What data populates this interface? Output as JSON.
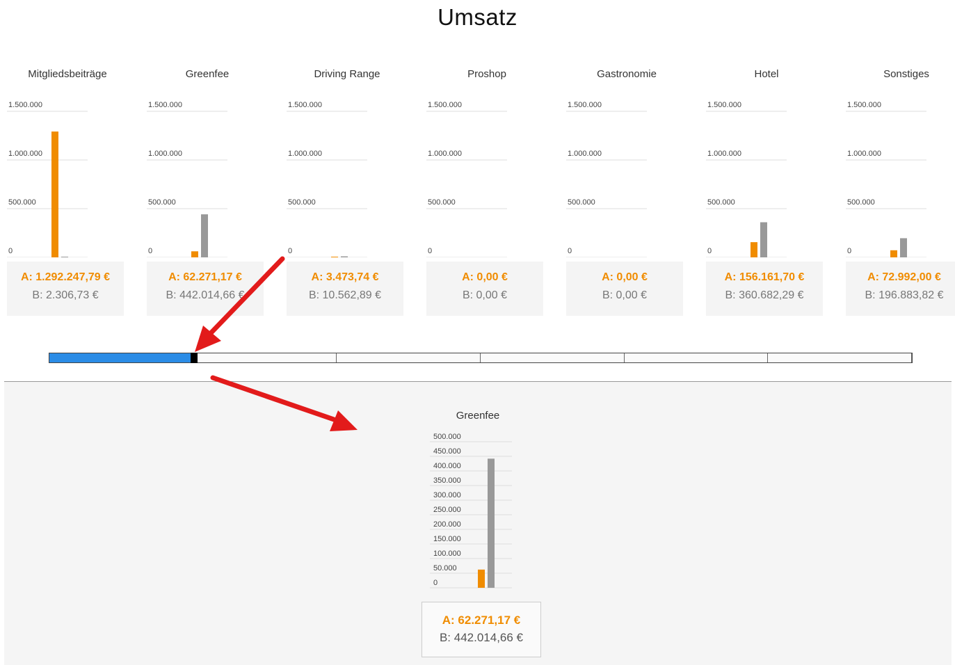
{
  "title": "Umsatz",
  "colors": {
    "a": "#f08c00",
    "b": "#999999",
    "slider_active": "#2b8ce6",
    "arrow": "#e21b1b"
  },
  "panels": [
    {
      "name": "Mitgliedsbeiträge",
      "a": 1292247.79,
      "b": 2306.73,
      "a_label": "A: 1.292.247,79 €",
      "b_label": "B: 2.306,73 €"
    },
    {
      "name": "Greenfee",
      "a": 62271.17,
      "b": 442014.66,
      "a_label": "A: 62.271,17 €",
      "b_label": "B: 442.014,66 €"
    },
    {
      "name": "Driving Range",
      "a": 3473.74,
      "b": 10562.89,
      "a_label": "A: 3.473,74 €",
      "b_label": "B: 10.562,89 €"
    },
    {
      "name": "Proshop",
      "a": 0,
      "b": 0,
      "a_label": "A: 0,00 €",
      "b_label": "B: 0,00 €"
    },
    {
      "name": "Gastronomie",
      "a": 0,
      "b": 0,
      "a_label": "A: 0,00 €",
      "b_label": "B: 0,00 €"
    },
    {
      "name": "Hotel",
      "a": 156161.7,
      "b": 360682.29,
      "a_label": "A: 156.161,70 €",
      "b_label": "B: 360.682,29 €"
    },
    {
      "name": "Sonstiges",
      "a": 72992.0,
      "b": 196883.82,
      "a_label": "A: 72.992,00 €",
      "b_label": "B: 196.883,82 €"
    }
  ],
  "panel_axis": {
    "ylim": [
      0,
      1500000
    ],
    "ticks": [
      0,
      500000,
      1000000,
      1500000
    ],
    "tick_labels": [
      "0",
      "500.000",
      "1.000.000",
      "1.500.000"
    ]
  },
  "slider": {
    "selected_index": 1,
    "segment_count": 6
  },
  "detail": {
    "title": "Greenfee",
    "a": 62271.17,
    "b": 442014.66,
    "a_label": "A: 62.271,17 €",
    "b_label": "B: 442.014,66 €",
    "ylim": [
      0,
      500000
    ],
    "ticks": [
      0,
      50000,
      100000,
      150000,
      200000,
      250000,
      300000,
      350000,
      400000,
      450000,
      500000
    ],
    "tick_labels": [
      "0",
      "50.000",
      "100.000",
      "150.000",
      "200.000",
      "250.000",
      "300.000",
      "350.000",
      "400.000",
      "450.000",
      "500.000"
    ]
  },
  "chart_data": [
    {
      "type": "bar",
      "title": "Umsatz",
      "categories": [
        "Mitgliedsbeiträge",
        "Greenfee",
        "Driving Range",
        "Proshop",
        "Gastronomie",
        "Hotel",
        "Sonstiges"
      ],
      "series": [
        {
          "name": "A",
          "values": [
            1292247.79,
            62271.17,
            3473.74,
            0,
            0,
            156161.7,
            72992.0
          ]
        },
        {
          "name": "B",
          "values": [
            2306.73,
            442014.66,
            10562.89,
            0,
            0,
            360682.29,
            196883.82
          ]
        }
      ],
      "ylim": [
        0,
        1500000
      ],
      "grid": true
    },
    {
      "type": "bar",
      "title": "Greenfee",
      "categories": [
        "Greenfee"
      ],
      "series": [
        {
          "name": "A",
          "values": [
            62271.17
          ]
        },
        {
          "name": "B",
          "values": [
            442014.66
          ]
        }
      ],
      "ylim": [
        0,
        500000
      ],
      "grid": true
    }
  ]
}
